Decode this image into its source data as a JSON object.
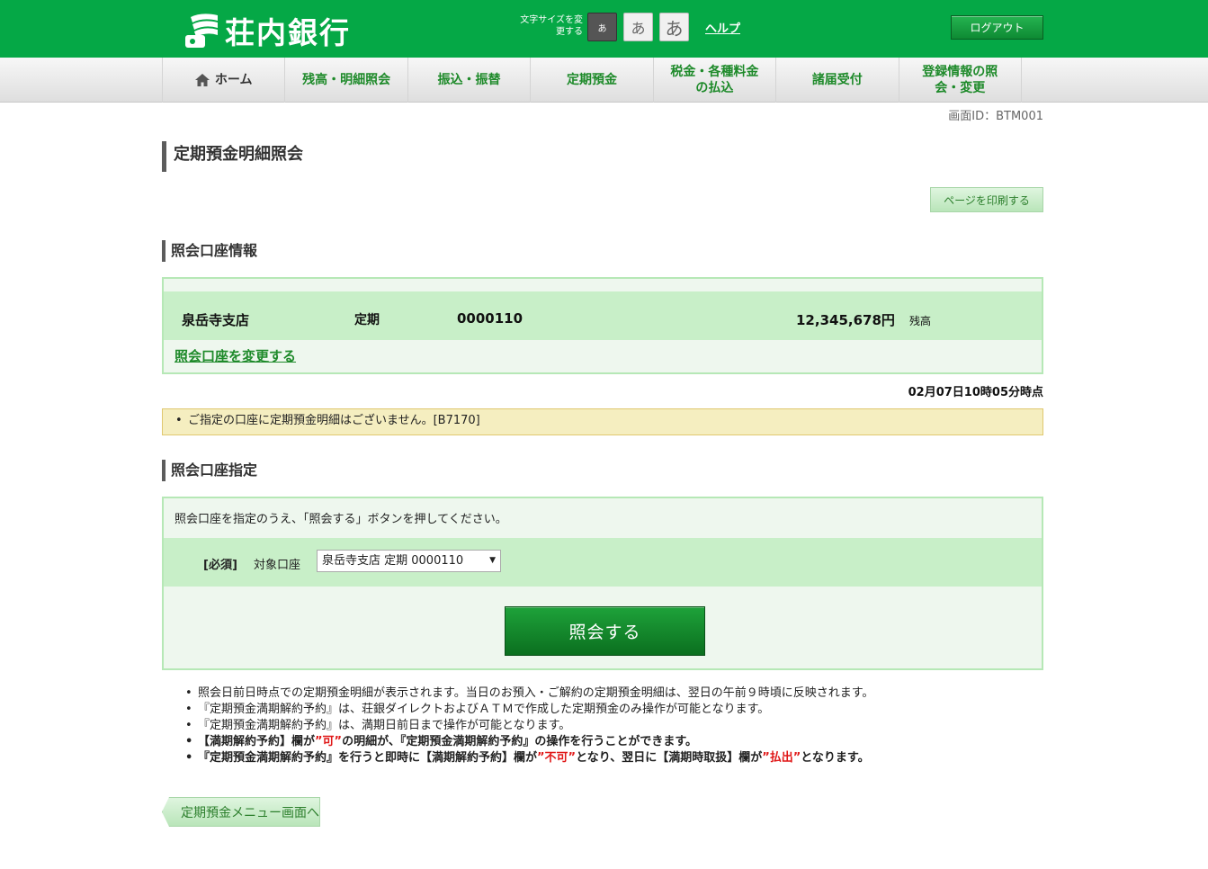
{
  "header": {
    "bank_name": "荘内銀行",
    "font_size_label": "文字サイズを変更する",
    "font_small": "あ",
    "font_medium": "あ",
    "font_large": "あ",
    "help": "ヘルプ",
    "logout": "ログアウト"
  },
  "nav": {
    "items": [
      {
        "label": "ホーム",
        "icon": "home-icon"
      },
      {
        "label": "残高・明細照会"
      },
      {
        "label": "振込・振替"
      },
      {
        "label": "定期預金"
      },
      {
        "label": "税金・各種料金の払込"
      },
      {
        "label": "諸届受付"
      },
      {
        "label": "登録情報の照会・変更"
      }
    ]
  },
  "screen_id": "画面ID：BTM001",
  "page_title": "定期預金明細照会",
  "print_button": "ページを印刷する",
  "account_info": {
    "section_title": "照会口座情報",
    "branch": "泉岳寺支店",
    "type": "定期",
    "number": "0000110",
    "balance": "12,345,678円",
    "balance_label": "残高",
    "change_link": "照会口座を変更する"
  },
  "timestamp": "02月07日10時05分時点",
  "notice": "ご指定の口座に定期預金明細はございません。[B7170]",
  "query": {
    "section_title": "照会口座指定",
    "description": "照会口座を指定のうえ、「照会する」ボタンを押してください。",
    "required": "[必須]",
    "target_label": "対象口座",
    "selected_account": "泉岳寺支店 定期 0000110",
    "submit": "照会する"
  },
  "notes": {
    "n1": "照会日前日時点での定期預金明細が表示されます。当日のお預入・ご解約の定期預金明細は、翌日の午前９時頃に反映されます。",
    "n2": "『定期預金満期解約予約』は、荘銀ダイレクトおよびＡＴＭで作成した定期預金のみ操作が可能となります。",
    "n3": "『定期預金満期解約予約』は、満期日前日まで操作が可能となります。",
    "n4a": "【満期解約予約】欄が",
    "n4b": "”可”",
    "n4c": "の明細が、『定期預金満期解約予約』の操作を行うことができます。",
    "n5a": "『定期預金満期解約予約』を行うと即時に【満期解約予約】欄が",
    "n5b": "”不可”",
    "n5c": "となり、翌日に【満期時取扱】欄が",
    "n5d": "”払出”",
    "n5e": "となります。"
  },
  "back_button": "定期預金メニュー画面へ",
  "colors": {
    "brand_green": "#05a846",
    "nav_text": "#1e8a2a",
    "highlight_red": "#e01818",
    "notice_bg": "#f5eec0"
  }
}
